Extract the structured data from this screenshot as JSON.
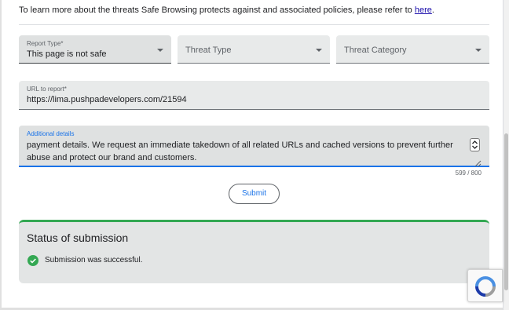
{
  "intro": {
    "text": "To learn more about the threats Safe Browsing protects against and associated policies, please refer to ",
    "link": "here",
    "tail": "."
  },
  "form": {
    "report_type": {
      "label": "Report Type*",
      "value": "This page is not safe",
      "icon": "chevron-down-icon"
    },
    "threat_type": {
      "placeholder": "Threat Type",
      "icon": "chevron-down-icon"
    },
    "threat_category": {
      "placeholder": "Threat Category",
      "icon": "chevron-down-icon"
    },
    "url": {
      "label": "URL to report*",
      "value": "https://lima.pushpadevelopers.com/21594"
    },
    "details": {
      "label": "Additional details",
      "value": "payment details. We request an immediate takedown of all related URLs and cached versions to prevent further abuse and protect our brand and customers.",
      "counter": "599 / 800"
    },
    "submit_label": "Submit"
  },
  "status": {
    "title": "Status of submission",
    "message": "Submission was successful.",
    "icon": "check-circle-icon"
  },
  "colors": {
    "accent": "#1a73e8",
    "success": "#34a853",
    "field_bg": "#e8eaea",
    "link": "#1a0dab"
  }
}
